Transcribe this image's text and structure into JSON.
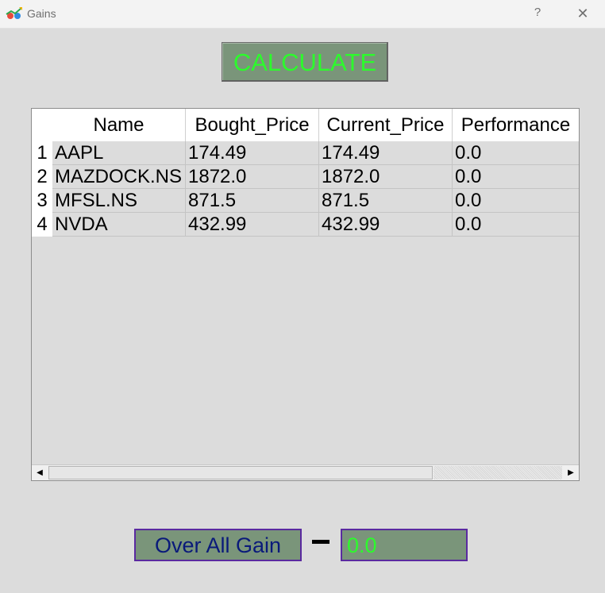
{
  "window": {
    "title": "Gains",
    "help_label": "?",
    "close_label": "✕",
    "icon": "chart-app-icon"
  },
  "toolbar": {
    "calculate_label": "CALCULATE"
  },
  "table": {
    "columns": [
      "Name",
      "Bought_Price",
      "Current_Price",
      "Performance"
    ],
    "row_numbers": [
      "1",
      "2",
      "3",
      "4"
    ],
    "rows": [
      [
        "AAPL",
        "174.49",
        "174.49",
        "0.0"
      ],
      [
        "MAZDOCK.NS",
        "1872.0",
        "1872.0",
        "0.0"
      ],
      [
        "MFSL.NS",
        "871.5",
        "871.5",
        "0.0"
      ],
      [
        "NVDA",
        "432.99",
        "432.99",
        "0.0"
      ]
    ]
  },
  "footer": {
    "gain_label": "Over All Gain",
    "gain_value": "0.0"
  },
  "colors": {
    "button_bg": "#7a957a",
    "button_text": "#2cfb2c",
    "label_text": "#0a1a7a",
    "border_purple": "#5a2aa0"
  }
}
